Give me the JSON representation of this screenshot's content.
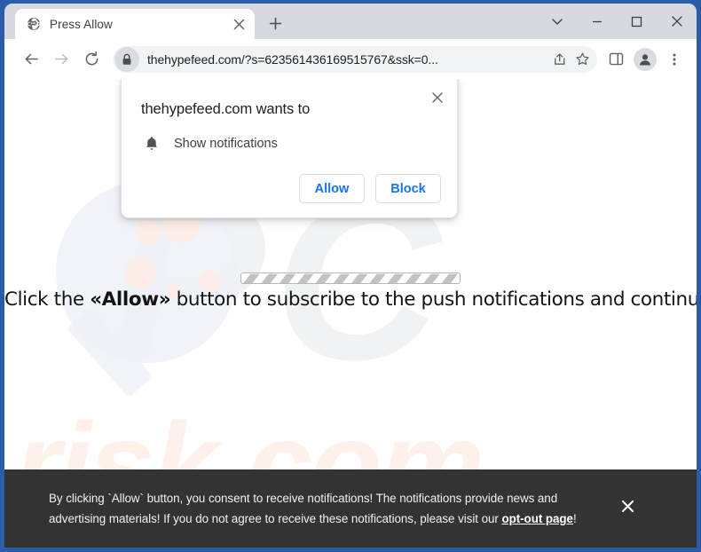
{
  "window": {
    "controls": {
      "tab_search": "chevron-down-icon",
      "minimize": "minimize-icon",
      "maximize": "maximize-icon",
      "close": "close-icon"
    }
  },
  "tabstrip": {
    "tab": {
      "title": "Press Allow",
      "favicon": "globe-icon",
      "close": "close-icon"
    },
    "new_tab": "plus-icon"
  },
  "toolbar": {
    "back": "back-arrow-icon",
    "forward": "forward-arrow-icon",
    "reload": "reload-icon",
    "lock": "lock-icon",
    "url": "thehypefeed.com/?s=623561436169515767&ssk=0...",
    "share": "share-icon",
    "bookmark": "star-icon",
    "side_panel": "side-panel-icon",
    "profile": "avatar-icon",
    "menu": "three-dot-menu-icon"
  },
  "permission_dialog": {
    "title": "thehypefeed.com wants to",
    "permission_icon": "bell-icon",
    "permission_label": "Show notifications",
    "allow_label": "Allow",
    "block_label": "Block",
    "close": "close-icon"
  },
  "page": {
    "headline_prefix": "Click the ",
    "headline_emphasis": "«Allow»",
    "headline_suffix": " button to subscribe to the push notifications and continue watching",
    "watermark_pc": "PC",
    "watermark_risk": "risk.com"
  },
  "banner": {
    "text_before_link": "By clicking `Allow` button, you consent to receive notifications! The notifications provide news and advertising materials! If you do not agree to receive these notifications, please visit our ",
    "link_label": "opt-out page",
    "text_after_link": "!",
    "close": "close-icon"
  },
  "colors": {
    "frame_blue": "#2a5da8",
    "tabstrip_grey": "#d6dae0",
    "accent_blue": "#1a73e8",
    "banner_dark": "#333333",
    "watermark_peach": "#fdf1e9"
  }
}
